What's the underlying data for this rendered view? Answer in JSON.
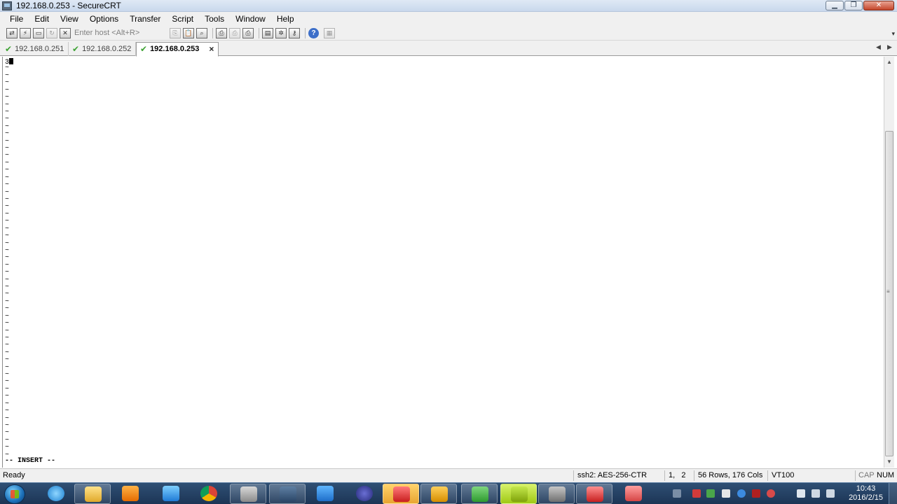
{
  "window": {
    "title": "192.168.0.253 - SecureCRT",
    "min_label": "▁",
    "max_label": "❐",
    "close_label": "✕"
  },
  "menu": [
    "File",
    "Edit",
    "View",
    "Options",
    "Transfer",
    "Script",
    "Tools",
    "Window",
    "Help"
  ],
  "toolbar": {
    "host_placeholder": "Enter host <Alt+R>",
    "help_label": "?"
  },
  "tabs": [
    {
      "label": "192.168.0.251",
      "active": false
    },
    {
      "label": "192.168.0.252",
      "active": false
    },
    {
      "label": "192.168.0.253",
      "active": true
    }
  ],
  "tab_close_label": "×",
  "terminal": {
    "first_line": "3",
    "tilde": "~",
    "mode_line": "-- INSERT --"
  },
  "status": {
    "ready": "Ready",
    "cipher": "ssh2: AES-256-CTR",
    "position": "1,   2",
    "size": "56 Rows, 176 Cols",
    "emulation": "VT100",
    "cap": "CAP",
    "num": "NUM"
  },
  "clock": {
    "time": "10:43",
    "date": "2016/2/15"
  },
  "colors": {
    "accent_check": "#3ea334",
    "taskbar_top": "#2f4f74",
    "taskbar_bottom": "#1c3555"
  }
}
